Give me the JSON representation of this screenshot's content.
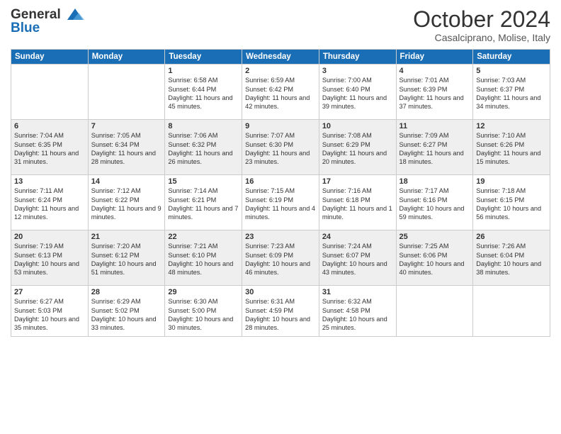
{
  "header": {
    "logo_line1": "General",
    "logo_line2": "Blue",
    "month": "October 2024",
    "location": "Casalciprano, Molise, Italy"
  },
  "weekdays": [
    "Sunday",
    "Monday",
    "Tuesday",
    "Wednesday",
    "Thursday",
    "Friday",
    "Saturday"
  ],
  "rows": [
    [
      {
        "day": "",
        "info": ""
      },
      {
        "day": "",
        "info": ""
      },
      {
        "day": "1",
        "info": "Sunrise: 6:58 AM\nSunset: 6:44 PM\nDaylight: 11 hours and 45 minutes."
      },
      {
        "day": "2",
        "info": "Sunrise: 6:59 AM\nSunset: 6:42 PM\nDaylight: 11 hours and 42 minutes."
      },
      {
        "day": "3",
        "info": "Sunrise: 7:00 AM\nSunset: 6:40 PM\nDaylight: 11 hours and 39 minutes."
      },
      {
        "day": "4",
        "info": "Sunrise: 7:01 AM\nSunset: 6:39 PM\nDaylight: 11 hours and 37 minutes."
      },
      {
        "day": "5",
        "info": "Sunrise: 7:03 AM\nSunset: 6:37 PM\nDaylight: 11 hours and 34 minutes."
      }
    ],
    [
      {
        "day": "6",
        "info": "Sunrise: 7:04 AM\nSunset: 6:35 PM\nDaylight: 11 hours and 31 minutes."
      },
      {
        "day": "7",
        "info": "Sunrise: 7:05 AM\nSunset: 6:34 PM\nDaylight: 11 hours and 28 minutes."
      },
      {
        "day": "8",
        "info": "Sunrise: 7:06 AM\nSunset: 6:32 PM\nDaylight: 11 hours and 26 minutes."
      },
      {
        "day": "9",
        "info": "Sunrise: 7:07 AM\nSunset: 6:30 PM\nDaylight: 11 hours and 23 minutes."
      },
      {
        "day": "10",
        "info": "Sunrise: 7:08 AM\nSunset: 6:29 PM\nDaylight: 11 hours and 20 minutes."
      },
      {
        "day": "11",
        "info": "Sunrise: 7:09 AM\nSunset: 6:27 PM\nDaylight: 11 hours and 18 minutes."
      },
      {
        "day": "12",
        "info": "Sunrise: 7:10 AM\nSunset: 6:26 PM\nDaylight: 11 hours and 15 minutes."
      }
    ],
    [
      {
        "day": "13",
        "info": "Sunrise: 7:11 AM\nSunset: 6:24 PM\nDaylight: 11 hours and 12 minutes."
      },
      {
        "day": "14",
        "info": "Sunrise: 7:12 AM\nSunset: 6:22 PM\nDaylight: 11 hours and 9 minutes."
      },
      {
        "day": "15",
        "info": "Sunrise: 7:14 AM\nSunset: 6:21 PM\nDaylight: 11 hours and 7 minutes."
      },
      {
        "day": "16",
        "info": "Sunrise: 7:15 AM\nSunset: 6:19 PM\nDaylight: 11 hours and 4 minutes."
      },
      {
        "day": "17",
        "info": "Sunrise: 7:16 AM\nSunset: 6:18 PM\nDaylight: 11 hours and 1 minute."
      },
      {
        "day": "18",
        "info": "Sunrise: 7:17 AM\nSunset: 6:16 PM\nDaylight: 10 hours and 59 minutes."
      },
      {
        "day": "19",
        "info": "Sunrise: 7:18 AM\nSunset: 6:15 PM\nDaylight: 10 hours and 56 minutes."
      }
    ],
    [
      {
        "day": "20",
        "info": "Sunrise: 7:19 AM\nSunset: 6:13 PM\nDaylight: 10 hours and 53 minutes."
      },
      {
        "day": "21",
        "info": "Sunrise: 7:20 AM\nSunset: 6:12 PM\nDaylight: 10 hours and 51 minutes."
      },
      {
        "day": "22",
        "info": "Sunrise: 7:21 AM\nSunset: 6:10 PM\nDaylight: 10 hours and 48 minutes."
      },
      {
        "day": "23",
        "info": "Sunrise: 7:23 AM\nSunset: 6:09 PM\nDaylight: 10 hours and 46 minutes."
      },
      {
        "day": "24",
        "info": "Sunrise: 7:24 AM\nSunset: 6:07 PM\nDaylight: 10 hours and 43 minutes."
      },
      {
        "day": "25",
        "info": "Sunrise: 7:25 AM\nSunset: 6:06 PM\nDaylight: 10 hours and 40 minutes."
      },
      {
        "day": "26",
        "info": "Sunrise: 7:26 AM\nSunset: 6:04 PM\nDaylight: 10 hours and 38 minutes."
      }
    ],
    [
      {
        "day": "27",
        "info": "Sunrise: 6:27 AM\nSunset: 5:03 PM\nDaylight: 10 hours and 35 minutes."
      },
      {
        "day": "28",
        "info": "Sunrise: 6:29 AM\nSunset: 5:02 PM\nDaylight: 10 hours and 33 minutes."
      },
      {
        "day": "29",
        "info": "Sunrise: 6:30 AM\nSunset: 5:00 PM\nDaylight: 10 hours and 30 minutes."
      },
      {
        "day": "30",
        "info": "Sunrise: 6:31 AM\nSunset: 4:59 PM\nDaylight: 10 hours and 28 minutes."
      },
      {
        "day": "31",
        "info": "Sunrise: 6:32 AM\nSunset: 4:58 PM\nDaylight: 10 hours and 25 minutes."
      },
      {
        "day": "",
        "info": ""
      },
      {
        "day": "",
        "info": ""
      }
    ]
  ]
}
